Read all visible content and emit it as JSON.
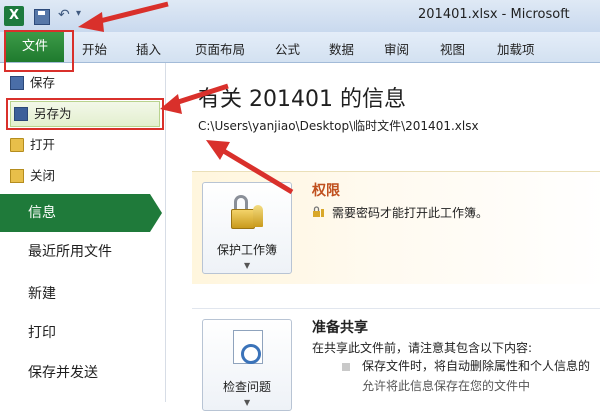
{
  "window": {
    "app_logo": "X",
    "title": "201401.xlsx - Microsoft"
  },
  "ribbon": {
    "file_tab": "文件",
    "tabs": [
      "开始",
      "插入",
      "页面布局",
      "公式",
      "数据",
      "审阅",
      "视图",
      "加载项"
    ]
  },
  "backstage": {
    "items": [
      {
        "label": "保存",
        "icon": "save-icon"
      },
      {
        "label": "另存为",
        "icon": "save-as-icon"
      },
      {
        "label": "打开",
        "icon": "open-folder-icon"
      },
      {
        "label": "关闭",
        "icon": "close-folder-icon"
      }
    ],
    "active": "信息",
    "nav": [
      "最近所用文件",
      "新建",
      "打印",
      "保存并发送"
    ]
  },
  "info": {
    "title": "有关 201401 的信息",
    "path": "C:\\Users\\yanjiao\\Desktop\\临时文件\\201401.xlsx",
    "permissions": {
      "button": "保护工作簿",
      "heading": "权限",
      "text": "需要密码才能打开此工作簿。"
    },
    "prepare": {
      "button": "检查问题",
      "heading": "准备共享",
      "text": "在共享此文件前，请注意其包含以下内容:",
      "bullets": [
        "保存文件时，将自动删除属性和个人信息的",
        "允许将此信息保存在您的文件中"
      ]
    }
  },
  "colors": {
    "file_tab": "#1f7a2e",
    "active_nav": "#1f7a3a",
    "annotation_red": "#d9302b"
  }
}
